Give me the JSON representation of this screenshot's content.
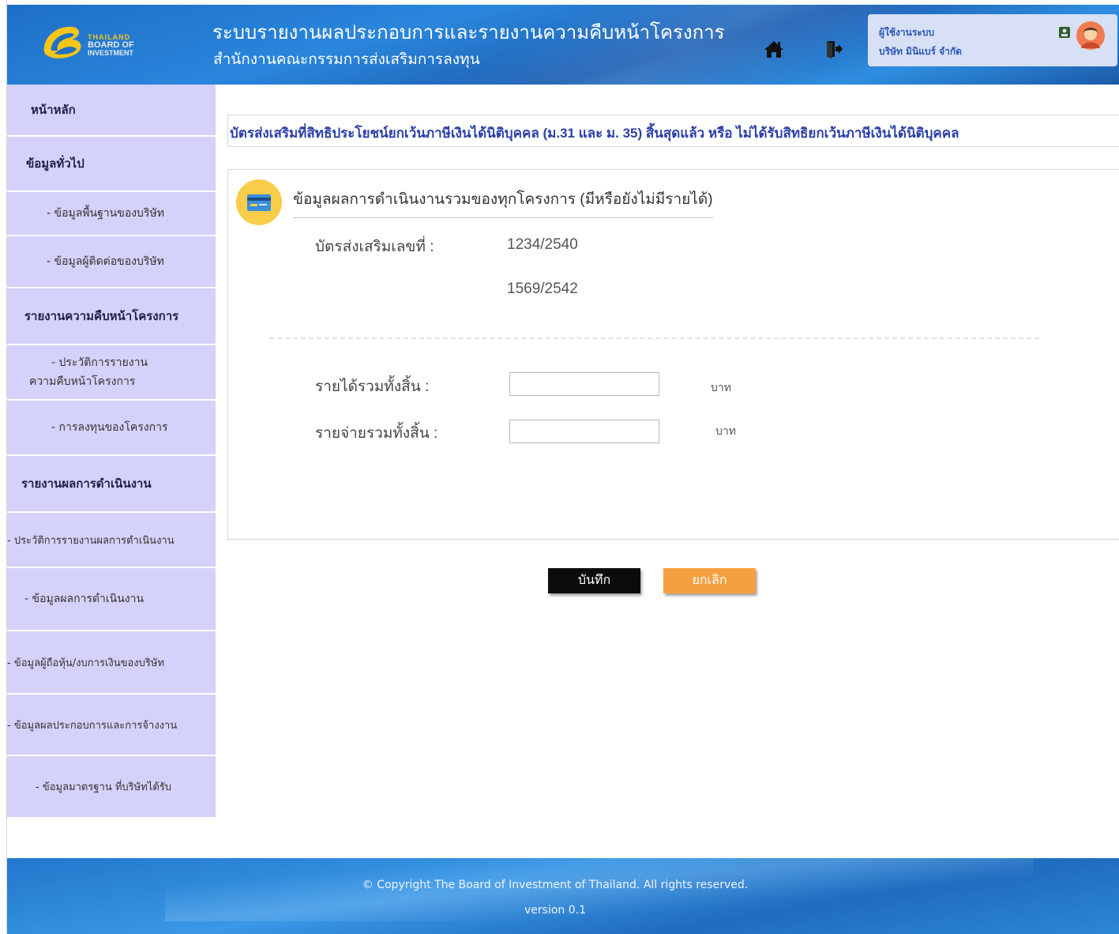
{
  "header": {
    "app_title": "ระบบรายงานผลประกอบการและรายงานความคืบหน้าโครงการ",
    "app_subtitle": "สำนักงานคณะกรรมการส่งเสริมการลงทุน",
    "logo": {
      "line1": "THAILAND",
      "line2": "BOARD OF",
      "line3": "INVESTMENT"
    },
    "user": {
      "role": "ผู้ใช้งานระบบ",
      "company": "บริษัท มินิแบร์ จำกัด"
    },
    "icons": {
      "home": "home-icon",
      "logout": "logout-icon",
      "id": "id-card-icon",
      "avatar": "user-avatar-icon"
    },
    "accent_color": "#1e6fc6"
  },
  "sidebar": {
    "items": [
      {
        "label": "หน้าหลัก",
        "type": "head"
      },
      {
        "label": "ข้อมูลทั่วไป",
        "type": "head"
      },
      {
        "label": "- ข้อมูลพื้นฐานของบริษัท",
        "type": "sub"
      },
      {
        "label": "- ข้อมูลผู้ติดต่อของบริษัท",
        "type": "sub"
      },
      {
        "label": "รายงานความคืบหน้าโครงการ",
        "type": "head"
      },
      {
        "label": "- ประวัติการรายงาน",
        "label2": "ความคืบหน้าโครงการ",
        "type": "sub"
      },
      {
        "label": "- การลงทุนของโครงการ",
        "type": "sub"
      },
      {
        "label": "รายงานผลการดำเนินงาน",
        "type": "head"
      },
      {
        "label": "- ประวัติการรายงานผลการดำเนินงาน",
        "type": "sub"
      },
      {
        "label": "- ข้อมูลผลการดำเนินงาน",
        "type": "sub"
      },
      {
        "label": "- ข้อมูลผู้ถือหุ้น/งบการเงินของบริษัท",
        "type": "sub"
      },
      {
        "label": "- ข้อมูลผลประกอบการและการจ้างงาน",
        "type": "sub"
      },
      {
        "label": "- ข้อมูลมาตรฐาน ที่บริษัทได้รับ",
        "type": "sub"
      }
    ],
    "bg_color": "#d4d2fa"
  },
  "main": {
    "title": "บัตรส่งเสริมที่สิทธิประโยชน์ยกเว้นภาษีเงินได้นิติบุคคล (ม.31 และ ม. 35) สิ้นสุดแล้ว หรือ  ไม่ได้รับสิทธิยกเว้นภาษีเงินได้นิติบุคคล",
    "section_title": "ข้อมูลผลการดำเนินงานรวมของทุกโครงการ (มีหรือยังไม่มีรายได้)",
    "section_icon": "credit-card-icon",
    "cert_label": "บัตรส่งเสริมเลขที่  :",
    "cert_numbers": [
      "1234/2540",
      "1569/2542"
    ],
    "income_label": "รายได้รวมทั้งสิ้น  :",
    "income_value": "",
    "income_unit": "บาท",
    "expense_label": "รายจ่ายรวมทั้งสิ้น  :",
    "expense_value": "",
    "expense_unit": "บาท",
    "save_label": "บันทึก",
    "cancel_label": "ยกเลิก",
    "save_color": "#0c0c0c",
    "cancel_color": "#f5a040"
  },
  "footer": {
    "copyright": "© Copyright The Board of Investment of Thailand. All rights reserved.",
    "version": "version 0.1"
  }
}
